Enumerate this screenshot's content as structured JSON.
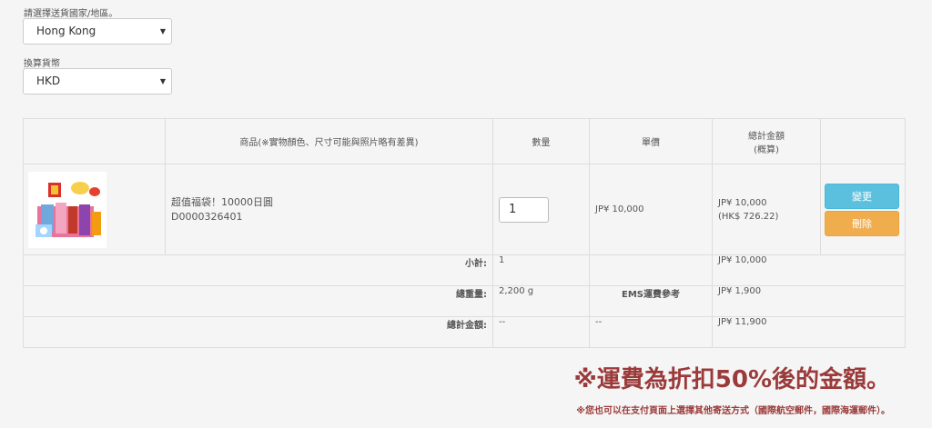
{
  "shipping": {
    "country_label": "請選擇送貨國家/地區。",
    "country_value": "Hong Kong",
    "currency_label": "換算貨幣",
    "currency_value": "HKD"
  },
  "cart": {
    "headers": {
      "image": "",
      "product": "商品(※實物顏色、尺寸可能與照片略有差異)",
      "quantity": "數量",
      "unit_price": "單價",
      "total_line1": "總計金額",
      "total_line2": "(概算)",
      "actions": ""
    },
    "item": {
      "name": "超值福袋！10000日圓",
      "code": "D0000326401",
      "quantity": "1",
      "unit_price": "JP¥ 10,000",
      "total_jpy": "JP¥ 10,000",
      "total_hkd": "(HK$ 726.22)",
      "change_label": "變更",
      "delete_label": "刪除"
    },
    "subtotal": {
      "label": "小計:",
      "quantity": "1",
      "amount": "JP¥ 10,000"
    },
    "weight": {
      "label": "總重量:",
      "value": "2,200 g",
      "ems_label": "EMS運費參考",
      "ems_amount": "JP¥ 1,900"
    },
    "grand_total": {
      "label": "總計金額:",
      "qty": "--",
      "unit": "--",
      "amount": "JP¥ 11,900"
    }
  },
  "notice": {
    "main": "※運費為折扣50%後的金額。",
    "sub": "※您也可以在支付頁面上選擇其他寄送方式（國際航空郵件，國際海運郵件）。"
  },
  "colors": {
    "change_button": "#5bc0de",
    "delete_button": "#f0ad4e",
    "notice_text": "#9b3a3a"
  }
}
